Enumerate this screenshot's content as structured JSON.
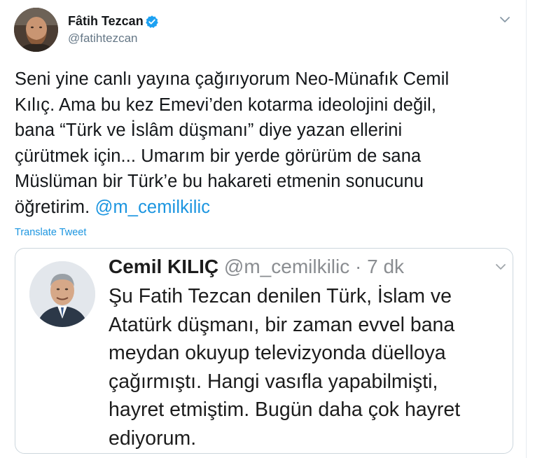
{
  "tweet": {
    "author_name": "Fâtih Tezcan",
    "handle": "@fatihtezcan",
    "verified_icon": "verified-badge-icon",
    "menu_icon": "chevron-down-icon",
    "text_lines": [
      "Seni yine canlı yayına çağırıyorum Neo-Münafık Cemil",
      "Kılıç. Ama bu kez Emevi’den kotarma ideolojini değil,",
      "bana “Türk ve İslâm düşmanı” diye yazan ellerini",
      "çürütmek için... Umarım bir yerde görürüm de sana",
      "Müslüman bir Türk’e bu hakareti etmenin sonucunu"
    ],
    "last_line_text": "öğretirim.",
    "mention": "@m_cemilkilic",
    "translate_label": "Translate Tweet"
  },
  "quoted": {
    "name": "Cemil KILIÇ",
    "meta": "@m_cemilkilic · 7 dk",
    "menu_icon": "chevron-down-icon",
    "text_lines": [
      "Şu Fatih Tezcan denilen Türk, İslam ve",
      "Atatürk düşmanı, bir zaman evvel bana",
      "meydan okuyup televizyonda düelloya",
      "çağırmıştı. Hangi vasıfla yapabilmişti,",
      "hayret etmiştim. Bugün daha çok hayret",
      "ediyorum."
    ]
  },
  "colors": {
    "link": "#1b95e0",
    "secondary_text": "#657786",
    "primary_text": "#14171a",
    "border": "#ccd6dd",
    "verified": "#1da1f2"
  }
}
